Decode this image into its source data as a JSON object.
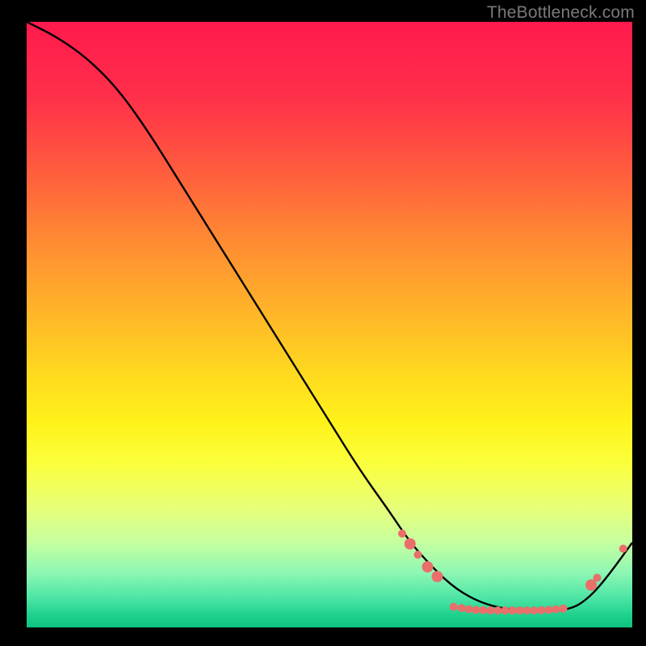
{
  "watermark": "TheBottleneck.com",
  "chart_data": {
    "type": "line",
    "title": "",
    "xlabel": "",
    "ylabel": "",
    "xlim": [
      0,
      100
    ],
    "ylim": [
      0,
      100
    ],
    "grid": false,
    "legend": false,
    "series": [
      {
        "name": "bottleneck-curve",
        "x": [
          0,
          5,
          10,
          15,
          20,
          25,
          30,
          35,
          40,
          45,
          50,
          55,
          60,
          63,
          66,
          70,
          74,
          78,
          82,
          86,
          90,
          93,
          96,
          100
        ],
        "y": [
          100,
          97.5,
          94,
          89,
          82,
          74,
          66,
          58,
          50,
          42,
          34,
          26,
          19,
          14.5,
          11,
          7,
          4.5,
          3.2,
          2.8,
          2.8,
          3,
          5,
          8.5,
          14
        ],
        "color": "#000000"
      }
    ],
    "markers": {
      "name": "data-points",
      "color": "#e96f6b",
      "radius_small": 5,
      "radius_large": 7,
      "points": [
        {
          "x": 62.0,
          "y": 15.5,
          "r": "small"
        },
        {
          "x": 63.3,
          "y": 13.8,
          "r": "large"
        },
        {
          "x": 64.6,
          "y": 12.0,
          "r": "small"
        },
        {
          "x": 66.2,
          "y": 10.0,
          "r": "large"
        },
        {
          "x": 67.8,
          "y": 8.4,
          "r": "large"
        },
        {
          "x": 70.5,
          "y": 3.4,
          "r": "small"
        },
        {
          "x": 71.8,
          "y": 3.2,
          "r": "small"
        },
        {
          "x": 73.0,
          "y": 3.0,
          "r": "small"
        },
        {
          "x": 74.2,
          "y": 2.9,
          "r": "small"
        },
        {
          "x": 75.4,
          "y": 2.85,
          "r": "small"
        },
        {
          "x": 76.6,
          "y": 2.8,
          "r": "small"
        },
        {
          "x": 77.8,
          "y": 2.8,
          "r": "small"
        },
        {
          "x": 79.0,
          "y": 2.8,
          "r": "small"
        },
        {
          "x": 80.2,
          "y": 2.8,
          "r": "small"
        },
        {
          "x": 81.4,
          "y": 2.8,
          "r": "small"
        },
        {
          "x": 82.6,
          "y": 2.8,
          "r": "small"
        },
        {
          "x": 83.8,
          "y": 2.8,
          "r": "small"
        },
        {
          "x": 85.0,
          "y": 2.85,
          "r": "small"
        },
        {
          "x": 86.2,
          "y": 2.9,
          "r": "small"
        },
        {
          "x": 87.4,
          "y": 3.0,
          "r": "small"
        },
        {
          "x": 88.6,
          "y": 3.1,
          "r": "small"
        },
        {
          "x": 93.2,
          "y": 7.0,
          "r": "large"
        },
        {
          "x": 94.2,
          "y": 8.2,
          "r": "small"
        },
        {
          "x": 98.5,
          "y": 13.0,
          "r": "small"
        }
      ]
    }
  }
}
